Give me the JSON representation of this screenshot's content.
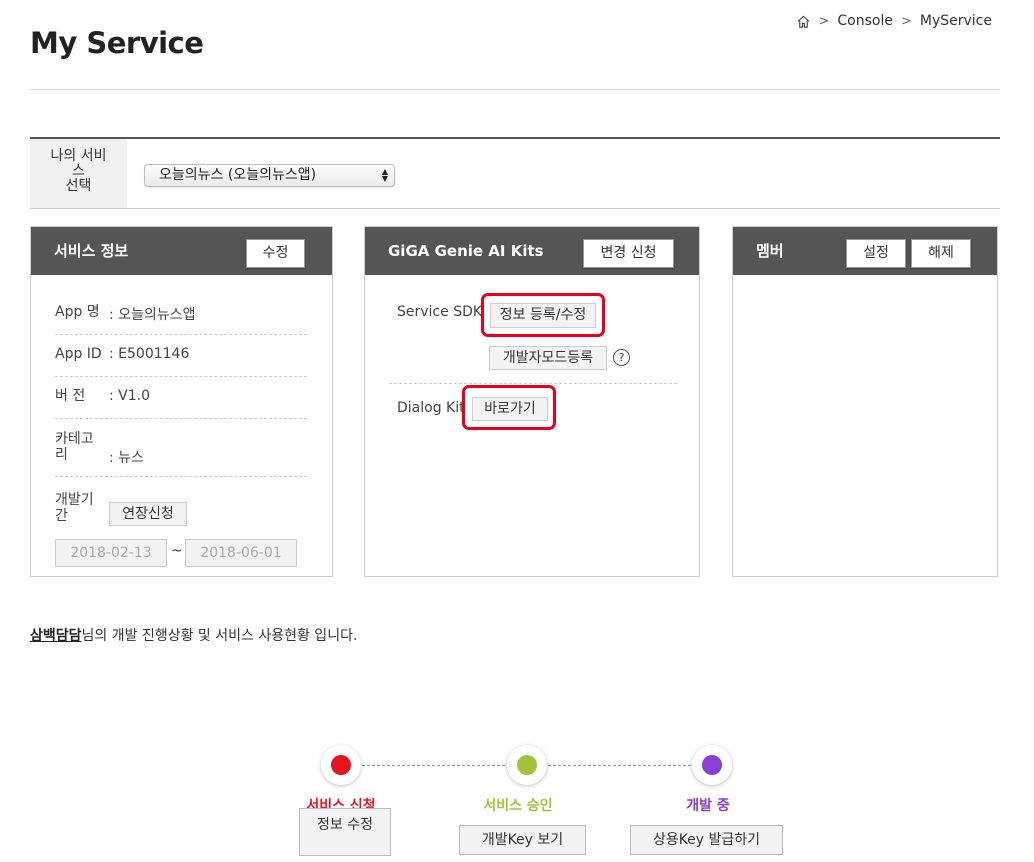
{
  "page": {
    "title": "My Service"
  },
  "breadcrumb": {
    "items": [
      "Console",
      "MyService"
    ]
  },
  "service_select": {
    "label": "나의 서비스 선택",
    "value": "오늘의뉴스 (오늘의뉴스앱)"
  },
  "service_info": {
    "title": "서비스 정보",
    "edit_label": "수정",
    "rows": [
      {
        "label": "App 명",
        "value": ": 오늘의뉴스앱"
      },
      {
        "label": "App ID",
        "value": ": E5001146"
      },
      {
        "label": "버 전",
        "value": ": V1.0"
      },
      {
        "label": "카테고리",
        "value": ": 뉴스"
      },
      {
        "label": "개발기간",
        "extend_label": "연장신청"
      }
    ],
    "period": {
      "start": "2018-02-13",
      "tilde": "~",
      "end": "2018-06-01"
    }
  },
  "kits": {
    "title": "GiGA Genie AI Kits",
    "change_label": "변경 신청",
    "sdk_label": "Service SDK",
    "sdk_register_label": "정보 등록/수정",
    "dev_mode_label": "개발자모드등록",
    "help_symbol": "?",
    "dialog_label": "Dialog Kit",
    "dialog_go_label": "바로가기"
  },
  "member": {
    "title": "멤버",
    "setting_label": "설정",
    "release_label": "해제"
  },
  "intro": {
    "user": "삼백담담",
    "text": "님의 개발 진행상황 및 서비스 사용현황 입니다."
  },
  "steps": [
    {
      "label": "서비스 신청",
      "color": "#e8141e",
      "button": "정보 수정"
    },
    {
      "label": "서비스 승인",
      "color": "#a3c43a",
      "button": "개발Key 보기"
    },
    {
      "label": "개발 중",
      "color": "#8b3fd6",
      "button": "상용Key 발급하기"
    }
  ],
  "colors": {
    "highlight": "#e8001c",
    "panel_header": "#555555"
  }
}
